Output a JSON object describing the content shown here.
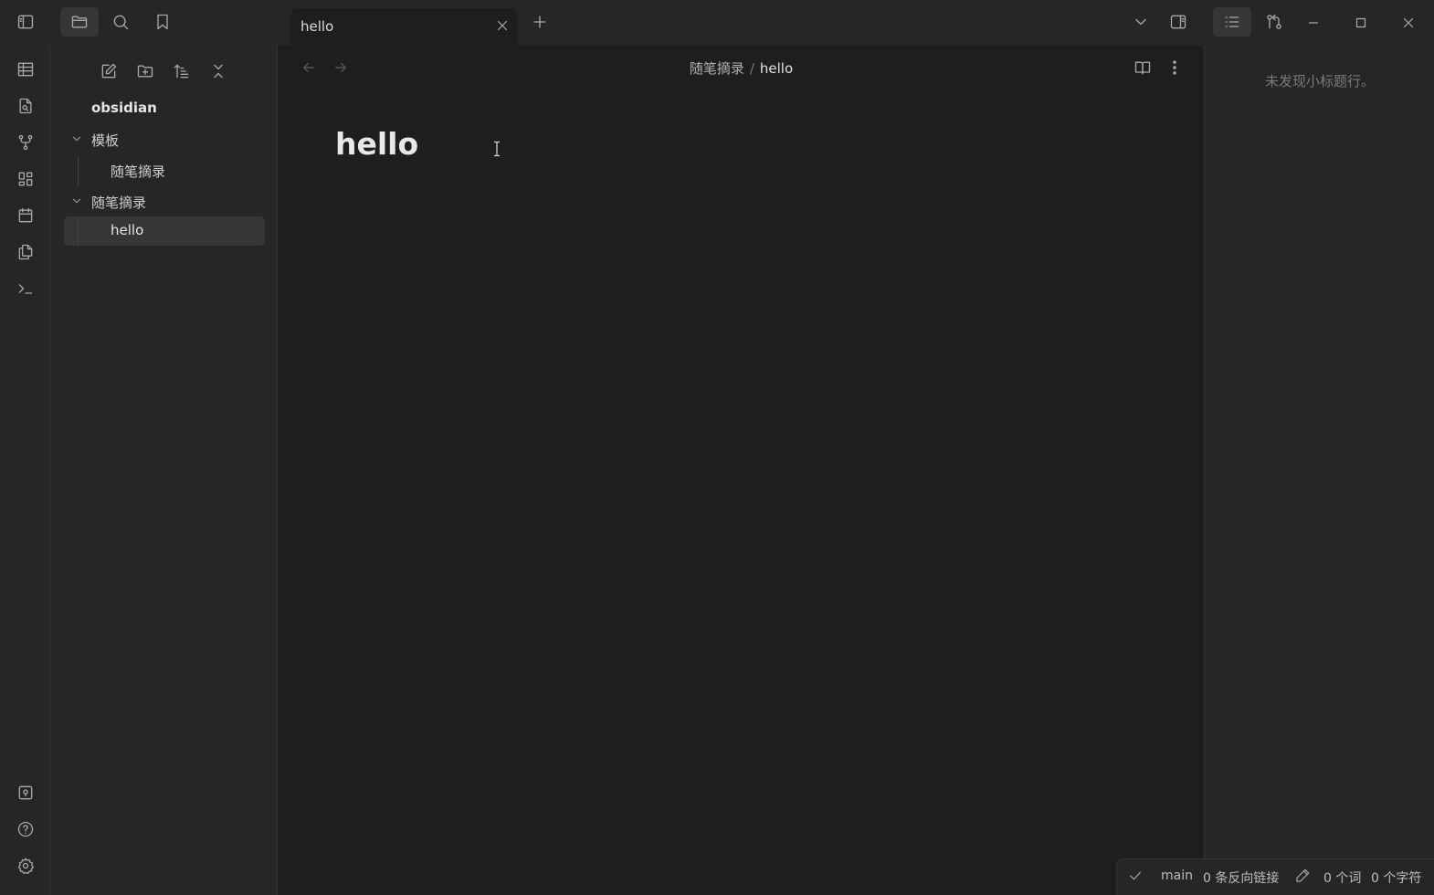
{
  "titlebar": {
    "tab_title": "hello"
  },
  "explorer": {
    "vault_name": "obsidian",
    "folders": [
      {
        "label": "模板",
        "children": [
          "随笔摘录"
        ]
      },
      {
        "label": "随笔摘录",
        "children": [
          "hello"
        ]
      }
    ]
  },
  "editor": {
    "breadcrumb_folder": "随笔摘录",
    "breadcrumb_separator": "/",
    "breadcrumb_file": "hello",
    "note_title": "hello"
  },
  "rightbar": {
    "outline_empty": "未发现小标题行。"
  },
  "statusbar": {
    "branch": "main",
    "backlinks": "0 条反向链接",
    "words": "0 个词",
    "chars": "0 个字符"
  },
  "colors": {
    "background": "#1e1e1e",
    "panel": "#262626",
    "selected": "#363636",
    "text": "#dadada",
    "muted": "#7a7a7a"
  }
}
